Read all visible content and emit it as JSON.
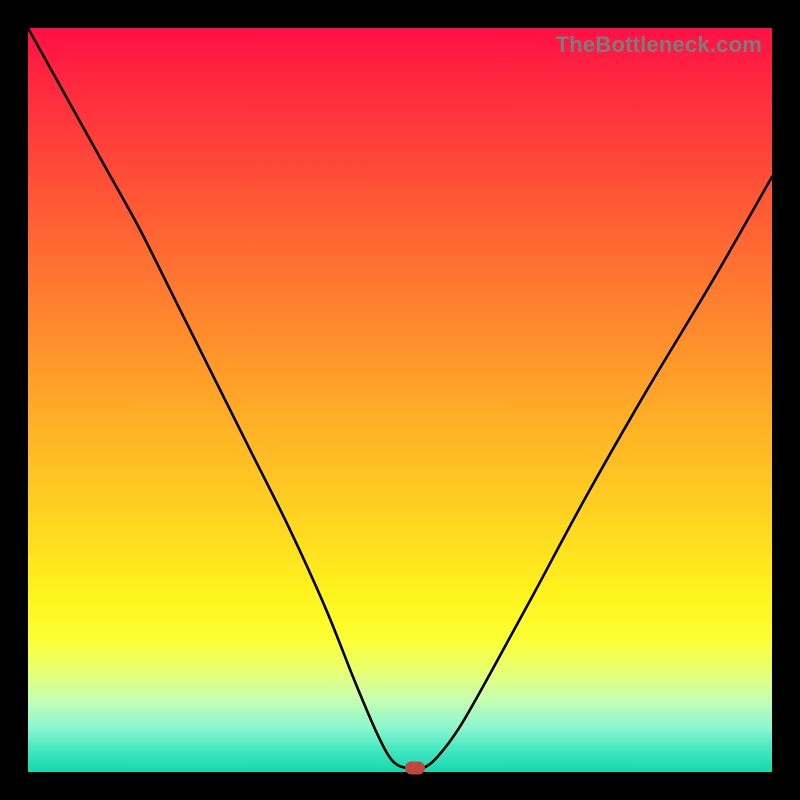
{
  "watermark": "TheBottleneck.com",
  "chart_data": {
    "type": "line",
    "title": "",
    "xlabel": "",
    "ylabel": "",
    "xlim": [
      0,
      100
    ],
    "ylim": [
      0,
      100
    ],
    "grid": false,
    "legend": false,
    "series": [
      {
        "name": "bottleneck-curve",
        "x": [
          0,
          5,
          10,
          15,
          20,
          25,
          30,
          35,
          40,
          44,
          47,
          49,
          51,
          53,
          55,
          58,
          62,
          68,
          75,
          83,
          92,
          100
        ],
        "y": [
          100,
          91,
          82,
          73,
          63,
          53,
          43,
          33,
          22,
          12,
          5,
          1.5,
          0.5,
          0.5,
          2,
          6,
          13,
          24,
          37,
          51,
          66,
          80
        ]
      }
    ],
    "marker": {
      "x": 52,
      "y": 0.5,
      "color": "#c0463f"
    },
    "gradient_stops": [
      {
        "pos": 0,
        "color": "#ff0f45"
      },
      {
        "pos": 8,
        "color": "#ff2a3e"
      },
      {
        "pos": 18,
        "color": "#ff4738"
      },
      {
        "pos": 30,
        "color": "#ff6b32"
      },
      {
        "pos": 42,
        "color": "#ff8f2c"
      },
      {
        "pos": 54,
        "color": "#ffb326"
      },
      {
        "pos": 66,
        "color": "#ffd420"
      },
      {
        "pos": 76,
        "color": "#fff31c"
      },
      {
        "pos": 82,
        "color": "#fbff32"
      },
      {
        "pos": 86,
        "color": "#eaff6a"
      },
      {
        "pos": 90,
        "color": "#c9ffae"
      },
      {
        "pos": 94,
        "color": "#8cf7cf"
      },
      {
        "pos": 97,
        "color": "#44e7c0"
      },
      {
        "pos": 100,
        "color": "#13d9af"
      }
    ]
  }
}
